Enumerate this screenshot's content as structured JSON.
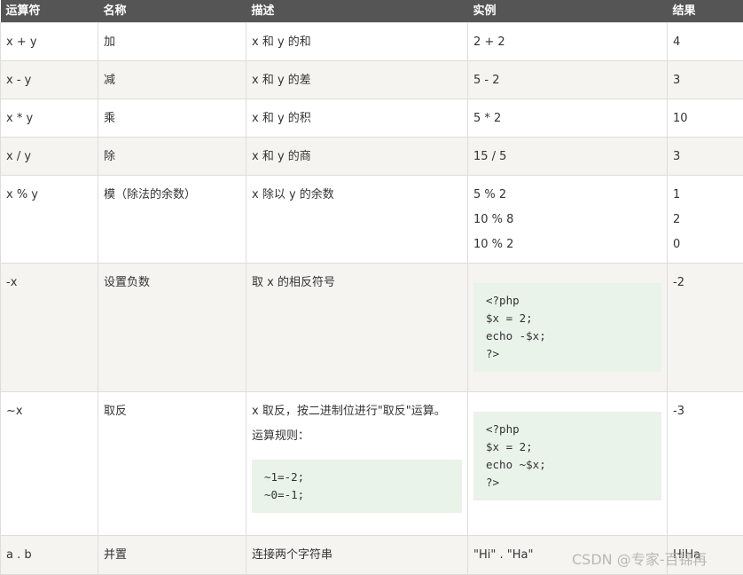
{
  "headers": [
    "运算符",
    "名称",
    "描述",
    "实例",
    "结果"
  ],
  "rows": [
    {
      "op": "x + y",
      "name": "加",
      "desc": "x 和 y 的和",
      "example": "2 + 2",
      "result": "4"
    },
    {
      "op": "x - y",
      "name": "减",
      "desc": "x 和 y 的差",
      "example": "5 - 2",
      "result": "3"
    },
    {
      "op": "x * y",
      "name": "乘",
      "desc": "x 和 y 的积",
      "example": "5 * 2",
      "result": "10"
    },
    {
      "op": "x / y",
      "name": "除",
      "desc": "x 和 y 的商",
      "example": "15 / 5",
      "result": "3"
    },
    {
      "op": "x % y",
      "name": "模（除法的余数）",
      "desc": "x 除以 y 的余数",
      "examples": [
        "5 % 2",
        "10 % 8",
        "10 % 2"
      ],
      "results": [
        "1",
        "2",
        "0"
      ]
    },
    {
      "op": "-x",
      "name": "设置负数",
      "desc": "取 x 的相反符号",
      "code": [
        "<?php",
        "$x = 2;",
        "echo -$x;",
        "?>"
      ],
      "result": "-2"
    },
    {
      "op": "~x",
      "name": "取反",
      "desc": "x 取反，按二进制位进行\"取反\"运算。",
      "desc2": "运算规则：",
      "desc_code": [
        "~1=-2;",
        "~0=-1;"
      ],
      "code": [
        "<?php",
        "$x = 2;",
        "echo ~$x;",
        "?>"
      ],
      "result": "-3"
    },
    {
      "op": "a . b",
      "name": "并置",
      "desc": "连接两个字符串",
      "example": "\"Hi\" . \"Ha\"",
      "result": "HiHa"
    }
  ],
  "watermark": "CSDN @专家-百锦再"
}
